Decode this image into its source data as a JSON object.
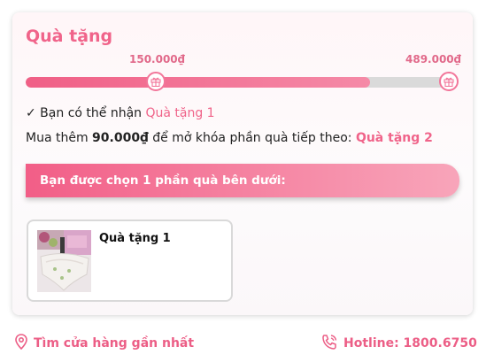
{
  "card": {
    "title": "Quà tặng",
    "progress": {
      "milestones": [
        "150.000₫",
        "489.000₫"
      ],
      "fill_fraction": 0.81
    },
    "line1": {
      "prefix": "✓ Bạn có thể nhận ",
      "gift": "Quà tặng 1"
    },
    "line2": {
      "prefix": "Mua thêm ",
      "amount": "90.000₫",
      "middle": " để mở khóa phần quà tiếp theo: ",
      "gift": "Quà tặng 2"
    },
    "banner": "Bạn được chọn 1 phần quà bên dưới:",
    "gift_item": {
      "name": "Quà tặng 1"
    }
  },
  "footer": {
    "store_link": "Tìm cửa hàng gần nhất",
    "hotline": "Hotline: 1800.6750"
  },
  "colors": {
    "accent": "#f0648a",
    "track": "#dadada"
  },
  "icons": [
    "gift-icon",
    "map-pin-icon",
    "phone-icon"
  ]
}
